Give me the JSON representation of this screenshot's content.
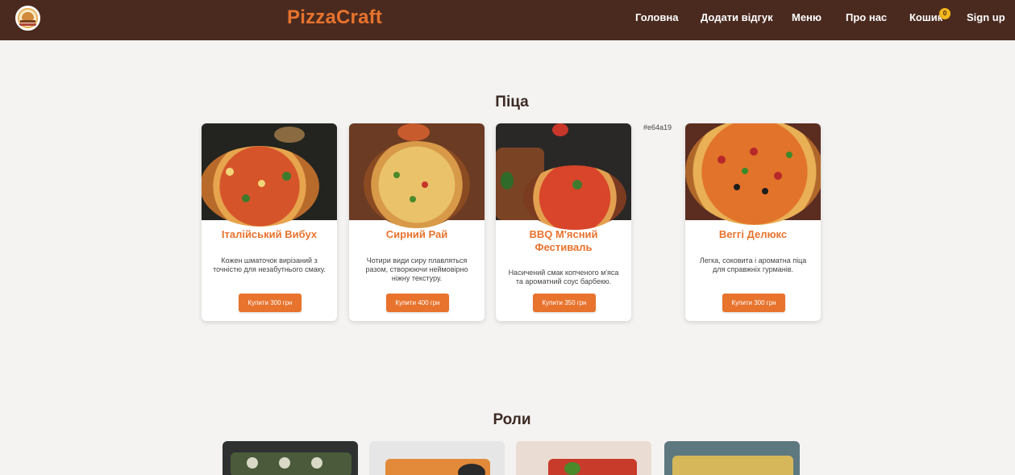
{
  "header": {
    "brand": "PizzaCraft",
    "nav": [
      "Головна",
      "Додати відгук",
      "Меню",
      "Про нас",
      "Кошик",
      "Sign up"
    ],
    "cart_count": "0"
  },
  "colors": {
    "header_bg": "#4a2a1f",
    "accent": "#e8732d",
    "badge": "#f2b71c"
  },
  "pizza_section": {
    "title": "Піца",
    "note": "#e64a19",
    "items": [
      {
        "name": "Італійський Вибух",
        "desc": "Кожен шматочок вирізаний з точністю для незабутнього смаку.",
        "button": "Купити 300 грн"
      },
      {
        "name": "Сирний Рай",
        "desc": "Чотири види сиру плавляться разом, створюючи неймовірно ніжну текстуру.",
        "button": "Купити 400 грн"
      },
      {
        "name": "BBQ М'ясний Фестиваль",
        "desc": "Насичений смак копченого м'яса та ароматний соус барбекю.",
        "button": "Купити 350 грн"
      },
      {
        "name": "Веггі Делюкс",
        "desc": "Легка, соковита і ароматна піца для справжніх гурманів.",
        "button": "Купити 300 грн"
      }
    ]
  },
  "rolls_section": {
    "title": "Роли"
  }
}
